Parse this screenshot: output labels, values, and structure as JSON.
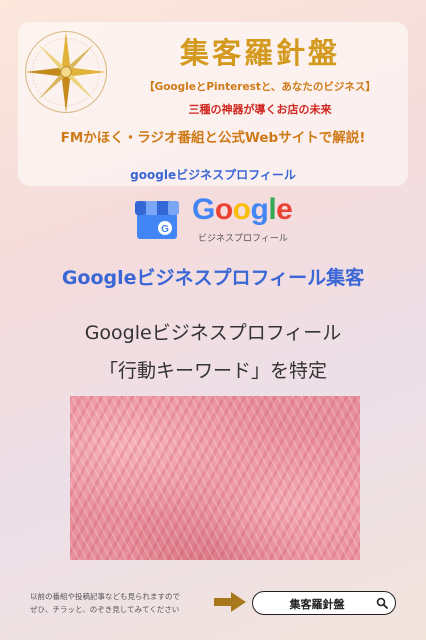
{
  "header": {
    "title": "集客羅針盤",
    "subtitle": "【GoogleとPinterestと、あなたのビジネス】",
    "tagline": "三種の神器が導くお店の未来",
    "radio_line": "FMかほく・ラジオ番組と公式Webサイトで解説!"
  },
  "gbp_logo": {
    "small_title": "googleビジネスプロフィール",
    "google_letters": [
      "G",
      "o",
      "o",
      "g",
      "l",
      "e"
    ],
    "google_colors": [
      "#4285F4",
      "#EA4335",
      "#FBBC05",
      "#4285F4",
      "#34A853",
      "#EA4335"
    ],
    "caption": "ビジネスプロフィール",
    "store_icon": "storefront-icon"
  },
  "main": {
    "heading": "Googleビジネスプロフィール集客",
    "subheading_line1": "Googleビジネスプロフィール",
    "subheading_line2": "「行動キーワード」を特定"
  },
  "footer": {
    "note_line1": "以前の番組や投稿記事なども見られますので",
    "note_line2": "ぜひ、チラッと、のぞき見してみてください",
    "search_text": "集客羅針盤",
    "arrow_icon": "arrow-right-icon",
    "search_icon": "search-icon",
    "arrow_color": "#a8791c"
  },
  "colors": {
    "gold": "#d49a1f",
    "orange": "#d07a17",
    "red": "#d0281f",
    "blue": "#3a66d6"
  }
}
